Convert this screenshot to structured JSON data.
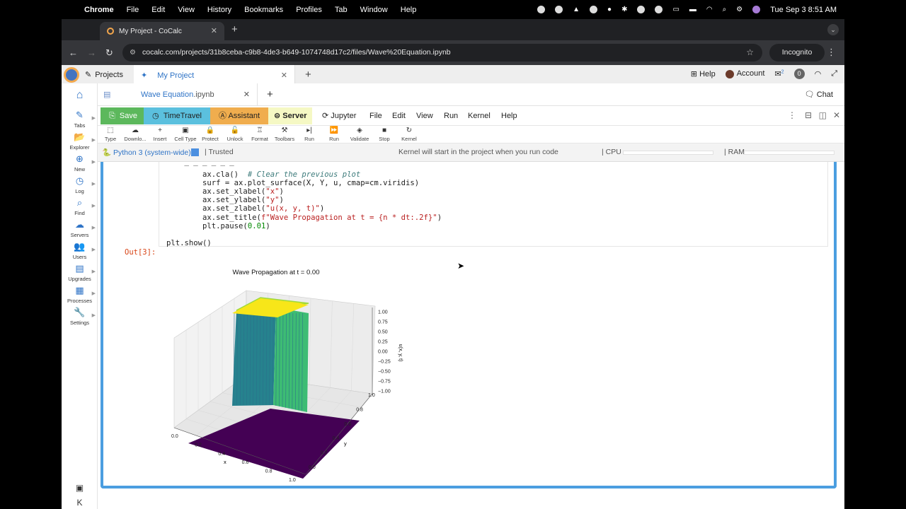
{
  "mac_menu": {
    "apple": "",
    "app": "Chrome",
    "items": [
      "File",
      "Edit",
      "View",
      "History",
      "Bookmarks",
      "Profiles",
      "Tab",
      "Window",
      "Help"
    ],
    "datetime": "Tue Sep 3  8:51 AM"
  },
  "browser": {
    "tab_title": "My Project - CoCalc",
    "url": "cocalc.com/projects/31b8ceba-c9b8-4de3-b649-1074748d17c2/files/Wave%20Equation.ipynb",
    "incognito": "Incognito"
  },
  "cocalc_top": {
    "projects": "Projects",
    "project_tab": "My Project",
    "help": "Help",
    "account": "Account",
    "notif_count": "2",
    "badge": "0"
  },
  "sidebar": [
    {
      "label": "Tabs",
      "icon": "✎"
    },
    {
      "label": "Explorer",
      "icon": "📂"
    },
    {
      "label": "New",
      "icon": "⊕"
    },
    {
      "label": "Log",
      "icon": "◷"
    },
    {
      "label": "Find",
      "icon": "⌕"
    },
    {
      "label": "Servers",
      "icon": "☁"
    },
    {
      "label": "Users",
      "icon": "👥"
    },
    {
      "label": "Upgrades",
      "icon": "▤"
    },
    {
      "label": "Processes",
      "icon": "▦"
    },
    {
      "label": "Settings",
      "icon": "🔧"
    }
  ],
  "file_tab": {
    "name": "Wave Equation",
    "ext": ".ipynb",
    "chat": "Chat"
  },
  "buttons": {
    "save": "Save",
    "timetravel": "TimeTravel",
    "assistant": "Assistant",
    "server": "Server"
  },
  "menus": [
    "Jupyter",
    "File",
    "Edit",
    "View",
    "Run",
    "Kernel",
    "Help"
  ],
  "toolbar": [
    "Type",
    "Downlo...",
    "Insert",
    "Cell Type",
    "Protect",
    "Unlock",
    "Format",
    "Toolbars",
    "Run",
    "Run",
    "Validate",
    "Stop",
    "Kernel"
  ],
  "status": {
    "kernel": "Python 3 (system-wide)",
    "trusted": "Trusted",
    "message": "Kernel will start in the project when you run code",
    "cpu": "CPU",
    "ram": "RAM"
  },
  "code_lines": [
    "        ax.cla()  # Clear the previous plot",
    "        surf = ax.plot_surface(X, Y, u, cmap=cm.viridis)",
    "        ax.set_xlabel(\"x\")",
    "        ax.set_ylabel(\"y\")",
    "        ax.set_zlabel(\"u(x, y, t)\")",
    "        ax.set_title(f\"Wave Propagation at t = {n * dt:.2f}\")",
    "        plt.pause(0.01)",
    "",
    "plt.show()"
  ],
  "output_label": "Out[3]:",
  "chart_data": {
    "type": "surface3d",
    "title": "Wave Propagation at t = 0.00",
    "xlabel": "x",
    "ylabel": "y",
    "zlabel": "u(x, y, t)",
    "x_ticks": [
      "0.0",
      "0.2",
      "0.4",
      "0.6",
      "0.8",
      "1.0"
    ],
    "y_ticks": [
      "0.0",
      "0.2",
      "0.4",
      "0.6",
      "0.8",
      "1.0"
    ],
    "z_ticks": [
      "1.00",
      "0.75",
      "0.50",
      "0.25",
      "0.00",
      "−0.25",
      "−0.50",
      "−0.75",
      "−1.00"
    ],
    "xlim": [
      0,
      1
    ],
    "ylim": [
      0,
      1
    ],
    "zlim": [
      -1,
      1
    ],
    "surface": {
      "description_value": "square pulse",
      "base": 0,
      "plateau": 1,
      "plateau_x": [
        0.4,
        0.6
      ],
      "plateau_y": [
        0.4,
        0.6
      ]
    },
    "colormap": "viridis"
  }
}
